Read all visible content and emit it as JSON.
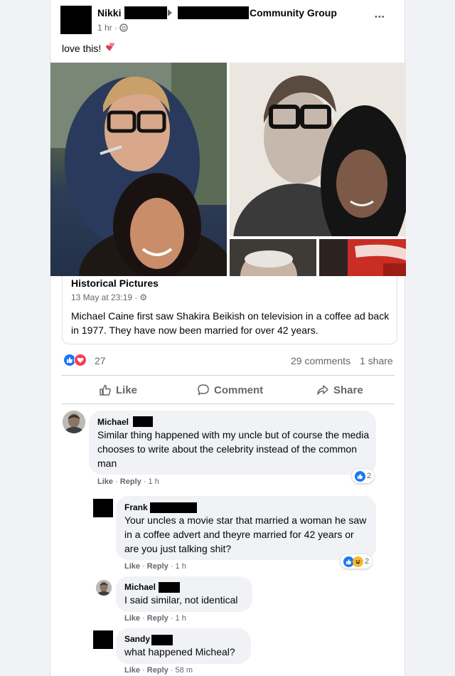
{
  "post": {
    "author": "Nikki",
    "group": "Community Group",
    "time": "1 hr ·",
    "text": "love this!",
    "more": "•••"
  },
  "shared": {
    "page_name": "Historical Pictures",
    "time": "13 May at 23:19 ·",
    "text": "Michael Caine first saw Shakira Beikish on television in a coffee ad back in 1977. They have now been married for over 42 years."
  },
  "stats": {
    "reactions": "27",
    "comments": "29 comments",
    "shares": "1 share"
  },
  "buttons": {
    "like": "Like",
    "comment": "Comment",
    "share": "Share"
  },
  "comments": [
    {
      "name": "Michael",
      "text": "Similar thing happened with my uncle but of course the media chooses to write about the celebrity instead of the common man",
      "like": "Like",
      "reply": "Reply",
      "time": "1 h",
      "reactions": "2"
    },
    {
      "name": "Frank",
      "text": "Your uncles a movie star that married a woman he saw in a coffee advert and theyre married for 42 years or are you just talking shit?",
      "like": "Like",
      "reply": "Reply",
      "time": "1 h",
      "reactions": "2"
    },
    {
      "name": "Michael",
      "text": "I said similar, not identical",
      "like": "Like",
      "reply": "Reply",
      "time": "1 h"
    },
    {
      "name": "Sandy",
      "text": "what happened Micheal?",
      "like": "Like",
      "reply": "Reply",
      "time": "58 m"
    }
  ],
  "colors": {
    "like_blue": "#1877f2",
    "love_red": "#f33e58",
    "haha_yellow": "#f7b928",
    "meta_gray": "#65676b",
    "bubble_gray": "#f0f2f5"
  }
}
